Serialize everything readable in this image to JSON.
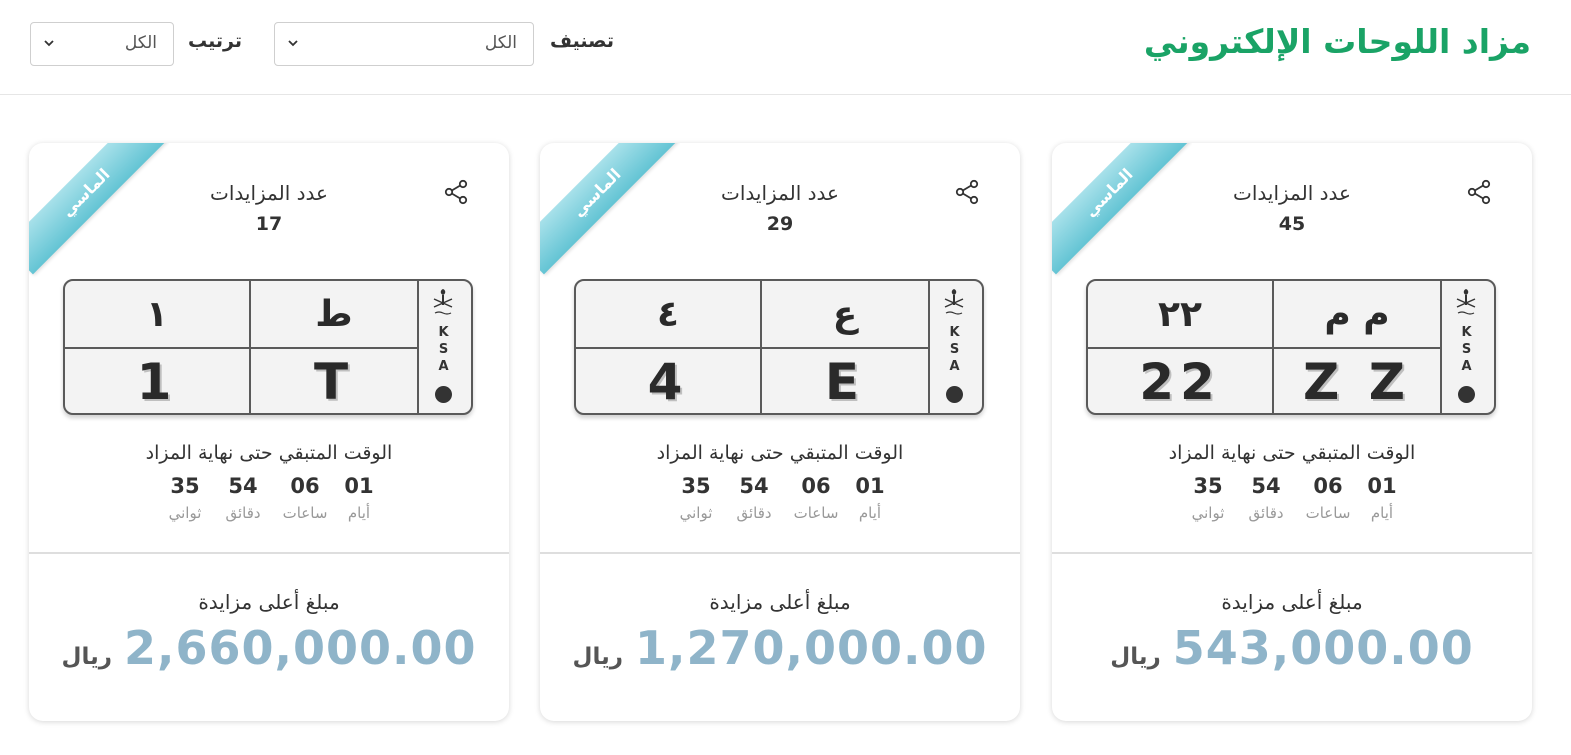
{
  "header": {
    "title": "مزاد اللوحات الإلكتروني",
    "category_label": "تصنيف",
    "category_value": "الكل",
    "sort_label": "ترتيب",
    "sort_value": "الكل",
    "brand_color": "#1aa366"
  },
  "cards": [
    {
      "ribbon": "الماسي",
      "bids_label": "عدد المزايدات",
      "bids_count": "45",
      "plate": {
        "ar_letters": "م م",
        "ar_numbers": "٢٢",
        "en_letters": "Z Z",
        "en_numbers": "22",
        "ksa": [
          "K",
          "S",
          "A"
        ]
      },
      "remaining_label": "الوقت المتبقي حتى نهاية المزاد",
      "countdown": [
        {
          "value": "01",
          "label": "أيام"
        },
        {
          "value": "06",
          "label": "ساعات"
        },
        {
          "value": "54",
          "label": "دقائق"
        },
        {
          "value": "35",
          "label": "ثواني"
        }
      ],
      "price_label": "مبلغ أعلى مزايدة",
      "price_amount": "543,000.00",
      "currency": "ريال"
    },
    {
      "ribbon": "الماسي",
      "bids_label": "عدد المزايدات",
      "bids_count": "29",
      "plate": {
        "ar_letters": "ع",
        "ar_numbers": "٤",
        "en_letters": "E",
        "en_numbers": "4",
        "ksa": [
          "K",
          "S",
          "A"
        ]
      },
      "remaining_label": "الوقت المتبقي حتى نهاية المزاد",
      "countdown": [
        {
          "value": "01",
          "label": "أيام"
        },
        {
          "value": "06",
          "label": "ساعات"
        },
        {
          "value": "54",
          "label": "دقائق"
        },
        {
          "value": "35",
          "label": "ثواني"
        }
      ],
      "price_label": "مبلغ أعلى مزايدة",
      "price_amount": "1,270,000.00",
      "currency": "ريال"
    },
    {
      "ribbon": "الماسي",
      "bids_label": "عدد المزايدات",
      "bids_count": "17",
      "plate": {
        "ar_letters": "ط",
        "ar_numbers": "١",
        "en_letters": "T",
        "en_numbers": "1",
        "ksa": [
          "K",
          "S",
          "A"
        ]
      },
      "remaining_label": "الوقت المتبقي حتى نهاية المزاد",
      "countdown": [
        {
          "value": "01",
          "label": "أيام"
        },
        {
          "value": "06",
          "label": "ساعات"
        },
        {
          "value": "54",
          "label": "دقائق"
        },
        {
          "value": "35",
          "label": "ثواني"
        }
      ],
      "price_label": "مبلغ أعلى مزايدة",
      "price_amount": "2,660,000.00",
      "currency": "ريال"
    }
  ]
}
